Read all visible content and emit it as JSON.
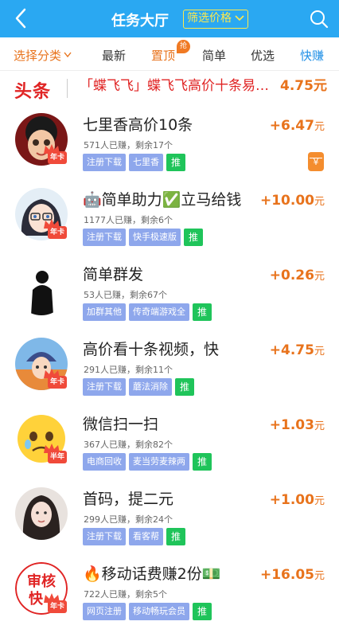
{
  "header": {
    "title": "任务大厅",
    "filter_label": "筛选价格",
    "colors": {
      "bar": "#2aa8f2",
      "filter": "#ffe94a"
    }
  },
  "tabs": [
    {
      "label": "选择分类"
    },
    {
      "label": "最新"
    },
    {
      "label": "置顶",
      "badge": "抢"
    },
    {
      "label": "简单"
    },
    {
      "label": "优选"
    },
    {
      "label": "快赚"
    }
  ],
  "headline": {
    "logo": "头条",
    "text": "「蝶飞飞」蝶飞飞高价十条易…",
    "price": "4.75元"
  },
  "tasks": [
    {
      "title": "七里香高价10条",
      "stat": "571人已赚，剩余17个",
      "tags": [
        "注册下载",
        "七里香"
      ],
      "push": "推",
      "reward": "+6.47",
      "unit": "元",
      "vip": "年卡",
      "wallet": "¥"
    },
    {
      "title": "🤖简单助力✅立马给钱",
      "stat": "1177人已赚，剩余6个",
      "tags": [
        "注册下载",
        "快手极速版"
      ],
      "push": "推",
      "reward": "+10.00",
      "unit": "元",
      "vip": "年卡"
    },
    {
      "title": "简单群发",
      "stat": "53人已赚，剩余67个",
      "tags": [
        "加群其他",
        "传奇端游戏全"
      ],
      "push": "推",
      "reward": "+0.26",
      "unit": "元"
    },
    {
      "title": "高价看十条视频，快",
      "stat": "291人已赚，剩余11个",
      "tags": [
        "注册下载",
        "蘑法消除"
      ],
      "push": "推",
      "reward": "+4.75",
      "unit": "元",
      "vip": "年卡"
    },
    {
      "title": "微信扫一扫",
      "stat": "367人已赚，剩余82个",
      "tags": [
        "电商回收",
        "麦当劳麦辣两"
      ],
      "push": "推",
      "reward": "+1.03",
      "unit": "元",
      "vip": "半年"
    },
    {
      "title": "首码，提二元",
      "stat": "299人已赚，剩余24个",
      "tags": [
        "注册下载",
        "看客帮"
      ],
      "push": "推",
      "reward": "+1.00",
      "unit": "元"
    },
    {
      "title": "🔥移动话费赚2份💵",
      "stat": "722人已赚，剩余5个",
      "tags": [
        "网页注册",
        "移动畅玩会员"
      ],
      "push": "推",
      "reward": "+16.05",
      "unit": "元",
      "vip": "年卡",
      "avatar_text": "审核快"
    }
  ]
}
